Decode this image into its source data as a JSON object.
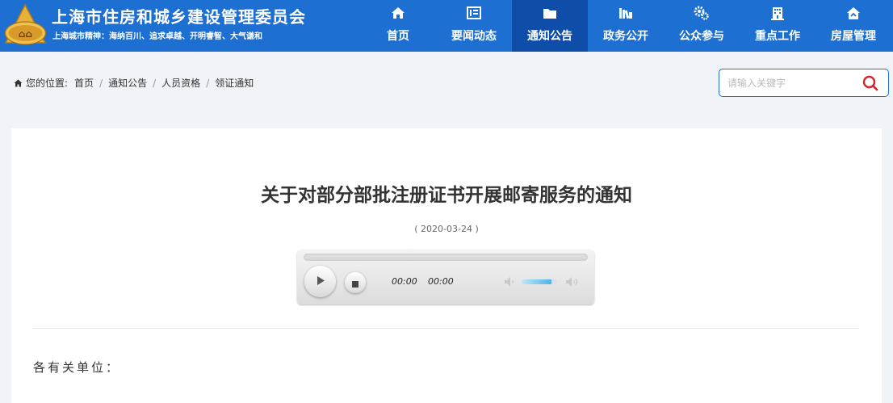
{
  "header": {
    "site_title": "上海市住房和城乡建设管理委员会",
    "slogan": "上海城市精神：海纳百川、追求卓越、开明睿智、大气谦和",
    "brand_color": "#1d6fd1",
    "active_color": "#0e4ea8",
    "nav": [
      {
        "label": "首页",
        "icon": "home-icon"
      },
      {
        "label": "要闻动态",
        "icon": "news-icon"
      },
      {
        "label": "通知公告",
        "icon": "folder-icon",
        "active": true
      },
      {
        "label": "政务公开",
        "icon": "books-icon"
      },
      {
        "label": "公众参与",
        "icon": "gears-icon"
      },
      {
        "label": "重点工作",
        "icon": "building-icon"
      },
      {
        "label": "房屋管理",
        "icon": "house-icon"
      }
    ]
  },
  "breadcrumb": {
    "prefix": "您的位置:",
    "items": [
      "首页",
      "通知公告",
      "人员资格",
      "领证通知"
    ],
    "separator": "/"
  },
  "search": {
    "placeholder": "请输入关键字",
    "value": ""
  },
  "article": {
    "title": "关于对部分部批注册证书开展邮寄服务的通知",
    "date": "( 2020-03-24 )",
    "salutation": "各有关单位："
  },
  "audio_player": {
    "current_time": "00:00",
    "duration": "00:00",
    "progress": 0,
    "volume": 0.85
  }
}
